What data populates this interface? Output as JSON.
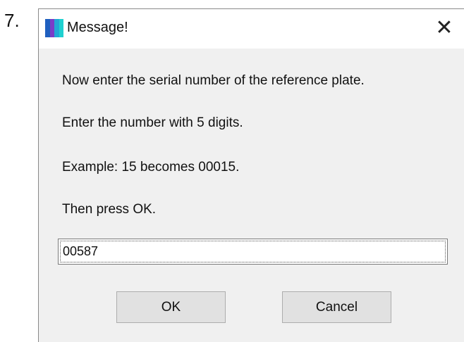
{
  "step": {
    "number": "7."
  },
  "window": {
    "title": "Message!",
    "close_glyph": "✕",
    "icon": "app-icon"
  },
  "message": {
    "line1": "Now enter the serial number of the reference plate.",
    "line2": "Enter the number with 5 digits.",
    "line3": "Example: 15 becomes 00015.",
    "line4": "Then press OK."
  },
  "input": {
    "value": "00587"
  },
  "buttons": {
    "ok_label": "OK",
    "cancel_label": "Cancel"
  },
  "colors": {
    "dialog_bg": "#f0f0f0",
    "titlebar_bg": "#ffffff",
    "button_bg": "#e1e1e1",
    "icon_colors": [
      "#1f5fbf",
      "#7a3cc8",
      "#22a7d6",
      "#1fd0d0"
    ]
  }
}
